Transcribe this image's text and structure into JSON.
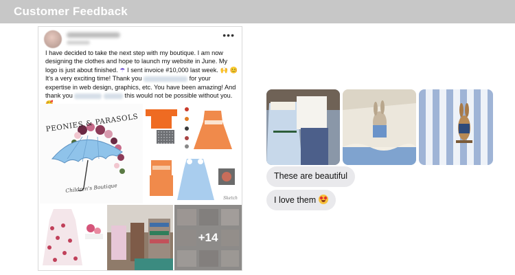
{
  "header": {
    "title": "Customer Feedback"
  },
  "post": {
    "more_label": "•••",
    "text_line1": "I have decided to take the next step with my boutique. I am now designing the clothes and hope to launch my website in June. My logo is just about finished.",
    "text_line2": "I sent invoice #10,000 last week.",
    "text_line3": "It's a very exciting time! Thank you",
    "text_line4": "for your expertise in web design, graphics, etc. You have been amazing! And thank you",
    "text_line5": "this would not be possible without you.",
    "logo_title": "PEONIES & PARASOLS",
    "logo_subtitle": "Children's Boutique",
    "more_photos": "+14"
  },
  "chat": {
    "bubble1": "These are beautiful",
    "bubble2": "I love them"
  },
  "colors": {
    "header_bg": "#c7c7c7",
    "bubble_bg": "#e9e9ec",
    "umbrella": "#8fc3ea",
    "gingham_orange": "#f08a4b"
  },
  "icons": [
    "more-options-icon",
    "umbrella-icon",
    "heart-eyes-emoji-icon"
  ]
}
